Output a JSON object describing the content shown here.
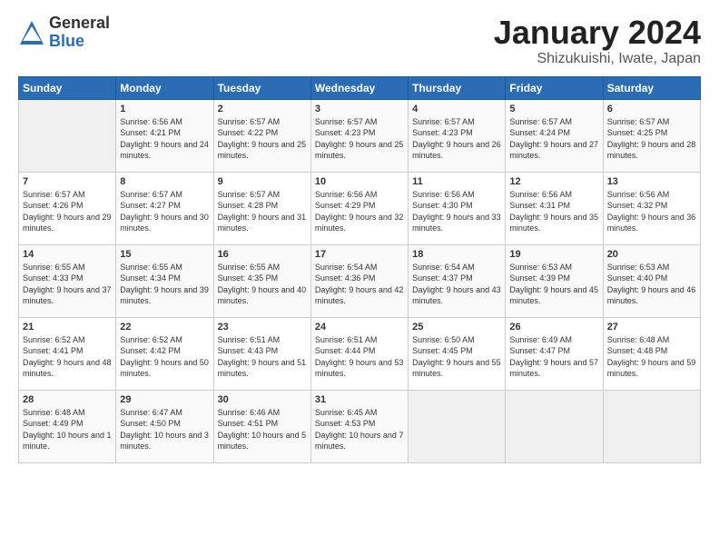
{
  "header": {
    "logo_general": "General",
    "logo_blue": "Blue",
    "month_title": "January 2024",
    "subtitle": "Shizukuishi, Iwate, Japan"
  },
  "weekdays": [
    "Sunday",
    "Monday",
    "Tuesday",
    "Wednesday",
    "Thursday",
    "Friday",
    "Saturday"
  ],
  "weeks": [
    [
      {
        "day": "",
        "sunrise": "",
        "sunset": "",
        "daylight": "",
        "empty": true
      },
      {
        "day": "1",
        "sunrise": "Sunrise: 6:56 AM",
        "sunset": "Sunset: 4:21 PM",
        "daylight": "Daylight: 9 hours and 24 minutes."
      },
      {
        "day": "2",
        "sunrise": "Sunrise: 6:57 AM",
        "sunset": "Sunset: 4:22 PM",
        "daylight": "Daylight: 9 hours and 25 minutes."
      },
      {
        "day": "3",
        "sunrise": "Sunrise: 6:57 AM",
        "sunset": "Sunset: 4:23 PM",
        "daylight": "Daylight: 9 hours and 25 minutes."
      },
      {
        "day": "4",
        "sunrise": "Sunrise: 6:57 AM",
        "sunset": "Sunset: 4:23 PM",
        "daylight": "Daylight: 9 hours and 26 minutes."
      },
      {
        "day": "5",
        "sunrise": "Sunrise: 6:57 AM",
        "sunset": "Sunset: 4:24 PM",
        "daylight": "Daylight: 9 hours and 27 minutes."
      },
      {
        "day": "6",
        "sunrise": "Sunrise: 6:57 AM",
        "sunset": "Sunset: 4:25 PM",
        "daylight": "Daylight: 9 hours and 28 minutes."
      }
    ],
    [
      {
        "day": "7",
        "sunrise": "Sunrise: 6:57 AM",
        "sunset": "Sunset: 4:26 PM",
        "daylight": "Daylight: 9 hours and 29 minutes."
      },
      {
        "day": "8",
        "sunrise": "Sunrise: 6:57 AM",
        "sunset": "Sunset: 4:27 PM",
        "daylight": "Daylight: 9 hours and 30 minutes."
      },
      {
        "day": "9",
        "sunrise": "Sunrise: 6:57 AM",
        "sunset": "Sunset: 4:28 PM",
        "daylight": "Daylight: 9 hours and 31 minutes."
      },
      {
        "day": "10",
        "sunrise": "Sunrise: 6:56 AM",
        "sunset": "Sunset: 4:29 PM",
        "daylight": "Daylight: 9 hours and 32 minutes."
      },
      {
        "day": "11",
        "sunrise": "Sunrise: 6:56 AM",
        "sunset": "Sunset: 4:30 PM",
        "daylight": "Daylight: 9 hours and 33 minutes."
      },
      {
        "day": "12",
        "sunrise": "Sunrise: 6:56 AM",
        "sunset": "Sunset: 4:31 PM",
        "daylight": "Daylight: 9 hours and 35 minutes."
      },
      {
        "day": "13",
        "sunrise": "Sunrise: 6:56 AM",
        "sunset": "Sunset: 4:32 PM",
        "daylight": "Daylight: 9 hours and 36 minutes."
      }
    ],
    [
      {
        "day": "14",
        "sunrise": "Sunrise: 6:55 AM",
        "sunset": "Sunset: 4:33 PM",
        "daylight": "Daylight: 9 hours and 37 minutes."
      },
      {
        "day": "15",
        "sunrise": "Sunrise: 6:55 AM",
        "sunset": "Sunset: 4:34 PM",
        "daylight": "Daylight: 9 hours and 39 minutes."
      },
      {
        "day": "16",
        "sunrise": "Sunrise: 6:55 AM",
        "sunset": "Sunset: 4:35 PM",
        "daylight": "Daylight: 9 hours and 40 minutes."
      },
      {
        "day": "17",
        "sunrise": "Sunrise: 6:54 AM",
        "sunset": "Sunset: 4:36 PM",
        "daylight": "Daylight: 9 hours and 42 minutes."
      },
      {
        "day": "18",
        "sunrise": "Sunrise: 6:54 AM",
        "sunset": "Sunset: 4:37 PM",
        "daylight": "Daylight: 9 hours and 43 minutes."
      },
      {
        "day": "19",
        "sunrise": "Sunrise: 6:53 AM",
        "sunset": "Sunset: 4:39 PM",
        "daylight": "Daylight: 9 hours and 45 minutes."
      },
      {
        "day": "20",
        "sunrise": "Sunrise: 6:53 AM",
        "sunset": "Sunset: 4:40 PM",
        "daylight": "Daylight: 9 hours and 46 minutes."
      }
    ],
    [
      {
        "day": "21",
        "sunrise": "Sunrise: 6:52 AM",
        "sunset": "Sunset: 4:41 PM",
        "daylight": "Daylight: 9 hours and 48 minutes."
      },
      {
        "day": "22",
        "sunrise": "Sunrise: 6:52 AM",
        "sunset": "Sunset: 4:42 PM",
        "daylight": "Daylight: 9 hours and 50 minutes."
      },
      {
        "day": "23",
        "sunrise": "Sunrise: 6:51 AM",
        "sunset": "Sunset: 4:43 PM",
        "daylight": "Daylight: 9 hours and 51 minutes."
      },
      {
        "day": "24",
        "sunrise": "Sunrise: 6:51 AM",
        "sunset": "Sunset: 4:44 PM",
        "daylight": "Daylight: 9 hours and 53 minutes."
      },
      {
        "day": "25",
        "sunrise": "Sunrise: 6:50 AM",
        "sunset": "Sunset: 4:45 PM",
        "daylight": "Daylight: 9 hours and 55 minutes."
      },
      {
        "day": "26",
        "sunrise": "Sunrise: 6:49 AM",
        "sunset": "Sunset: 4:47 PM",
        "daylight": "Daylight: 9 hours and 57 minutes."
      },
      {
        "day": "27",
        "sunrise": "Sunrise: 6:48 AM",
        "sunset": "Sunset: 4:48 PM",
        "daylight": "Daylight: 9 hours and 59 minutes."
      }
    ],
    [
      {
        "day": "28",
        "sunrise": "Sunrise: 6:48 AM",
        "sunset": "Sunset: 4:49 PM",
        "daylight": "Daylight: 10 hours and 1 minute."
      },
      {
        "day": "29",
        "sunrise": "Sunrise: 6:47 AM",
        "sunset": "Sunset: 4:50 PM",
        "daylight": "Daylight: 10 hours and 3 minutes."
      },
      {
        "day": "30",
        "sunrise": "Sunrise: 6:46 AM",
        "sunset": "Sunset: 4:51 PM",
        "daylight": "Daylight: 10 hours and 5 minutes."
      },
      {
        "day": "31",
        "sunrise": "Sunrise: 6:45 AM",
        "sunset": "Sunset: 4:53 PM",
        "daylight": "Daylight: 10 hours and 7 minutes."
      },
      {
        "day": "",
        "sunrise": "",
        "sunset": "",
        "daylight": "",
        "empty": true
      },
      {
        "day": "",
        "sunrise": "",
        "sunset": "",
        "daylight": "",
        "empty": true
      },
      {
        "day": "",
        "sunrise": "",
        "sunset": "",
        "daylight": "",
        "empty": true
      }
    ]
  ]
}
